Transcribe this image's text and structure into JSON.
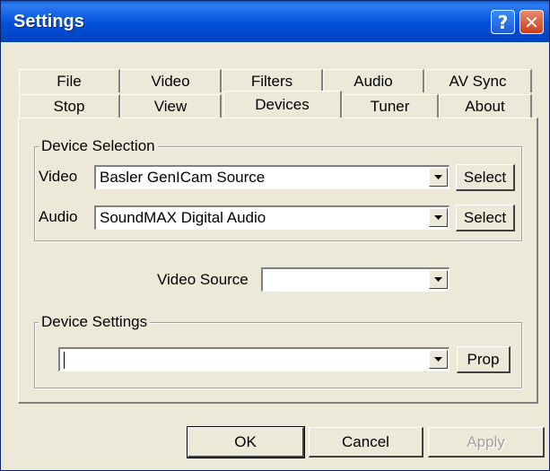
{
  "window": {
    "title": "Settings"
  },
  "titlebar_buttons": {
    "help": "?",
    "close": "✕"
  },
  "tabs": {
    "row1": [
      "File",
      "Video",
      "Filters",
      "Audio",
      "AV Sync"
    ],
    "row2": [
      "Stop",
      "View",
      "Devices",
      "Tuner",
      "About"
    ],
    "active": "Devices"
  },
  "device_selection": {
    "legend": "Device Selection",
    "video_label": "Video",
    "video_value": "Basler GenICam Source",
    "audio_label": "Audio",
    "audio_value": "SoundMAX Digital Audio",
    "select_label": "Select"
  },
  "video_source": {
    "label": "Video Source",
    "value": ""
  },
  "device_settings": {
    "legend": "Device Settings",
    "value": "",
    "prop_label": "Prop"
  },
  "buttons": {
    "ok": "OK",
    "cancel": "Cancel",
    "apply": "Apply"
  },
  "icons": {
    "dropdown": "chevron-down-icon"
  }
}
